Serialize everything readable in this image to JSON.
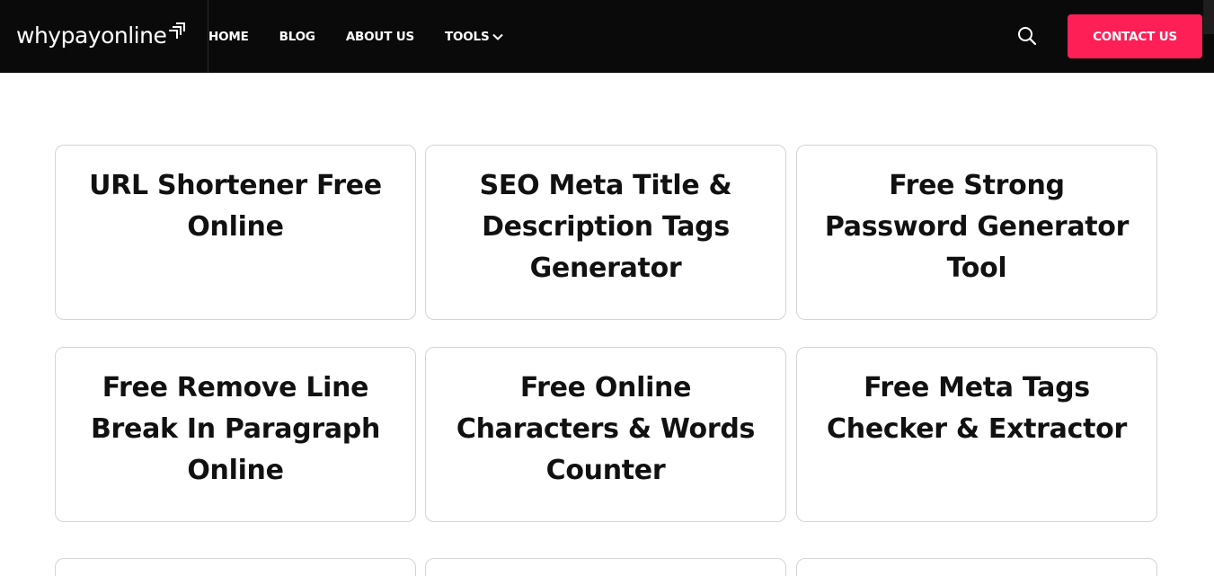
{
  "header": {
    "logo_text": "whypayonline",
    "nav": [
      {
        "label": "HOME"
      },
      {
        "label": "BLOG"
      },
      {
        "label": "ABOUT US"
      },
      {
        "label": "TOOLS"
      }
    ],
    "contact_label": "CONTACT US",
    "accent_color": "#ff1f57",
    "background_color": "#0a0a0a",
    "icons": {
      "search": "search-icon",
      "tools_dropdown": "chevron-down-icon",
      "logo_mark": "logo-arrows-icon"
    }
  },
  "tools": [
    {
      "title": "URL Shortener Free Online"
    },
    {
      "title": "SEO Meta Title & Description Tags Generator"
    },
    {
      "title": "Free Strong Password Generator Tool"
    },
    {
      "title": "Free Remove Line Break In Paragraph Online"
    },
    {
      "title": "Free Online Characters & Words Counter"
    },
    {
      "title": "Free Meta Tags Checker & Extractor"
    }
  ]
}
